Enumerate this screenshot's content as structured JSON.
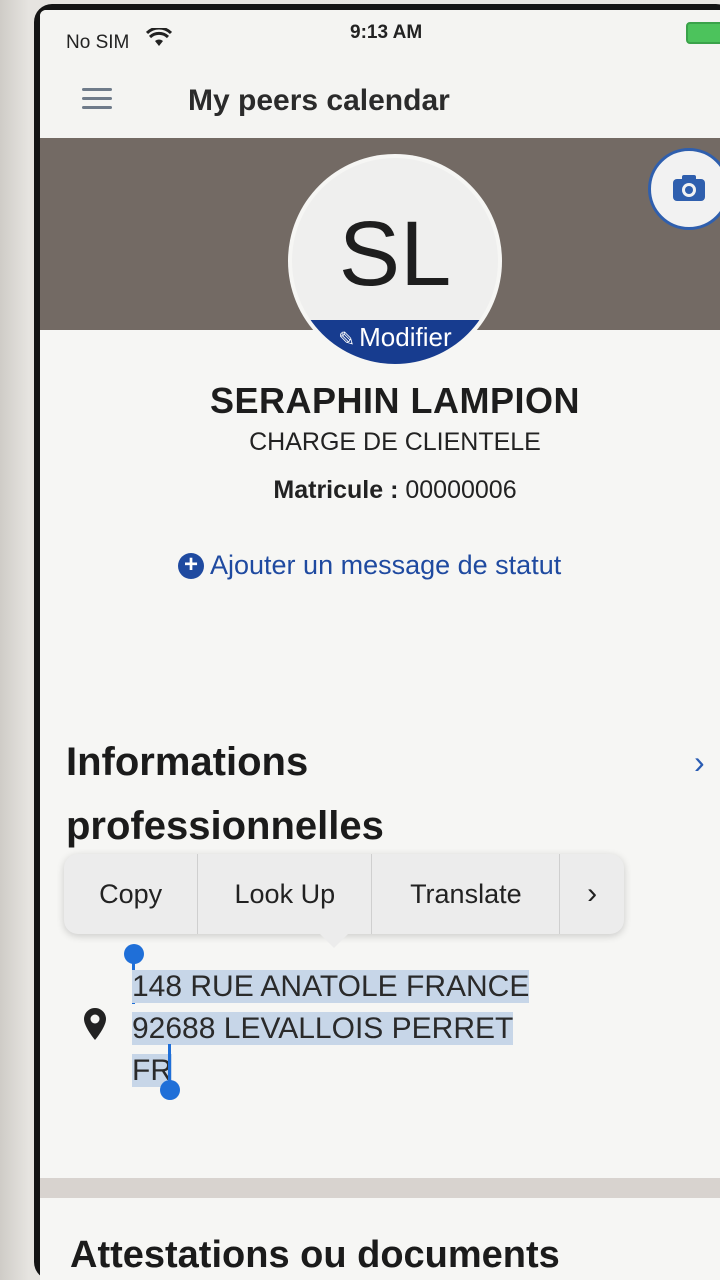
{
  "status_bar": {
    "carrier": "No SIM",
    "time": "9:13 AM"
  },
  "nav": {
    "title": "My peers calendar"
  },
  "profile": {
    "initials": "SL",
    "edit_label": "Modifier",
    "name": "SERAPHIN LAMPION",
    "job_title": "CHARGE DE CLIENTELE",
    "matricule_label": "Matricule :",
    "matricule_value": "00000006",
    "status_link": "Ajouter un message de statut"
  },
  "section": {
    "heading": "Informations professionnelles"
  },
  "context_menu": {
    "items": [
      "Copy",
      "Look Up",
      "Translate",
      "›"
    ]
  },
  "address": {
    "lines": [
      "148 RUE ANATOLE FRANCE",
      "92688 LEVALLOIS PERRET",
      "FR"
    ]
  },
  "next_section": {
    "heading": "Attestations ou documents"
  },
  "colors": {
    "accent": "#1f4aa0",
    "banner": "#736a64",
    "selection": "#c7d6e8"
  }
}
